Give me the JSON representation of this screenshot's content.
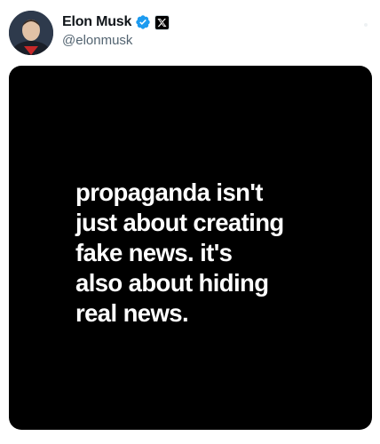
{
  "author": {
    "display_name": "Elon Musk",
    "handle": "@elonmusk",
    "verified_icon": "verified-badge-icon",
    "affiliation_icon": "x-logo-icon"
  },
  "media": {
    "text": "propaganda isn't\njust about creating\nfake news. it's\nalso about hiding\nreal news."
  },
  "colors": {
    "verified_blue": "#1d9bf0",
    "media_background": "#000000",
    "text_primary": "#0f1419",
    "text_secondary": "#536471"
  }
}
